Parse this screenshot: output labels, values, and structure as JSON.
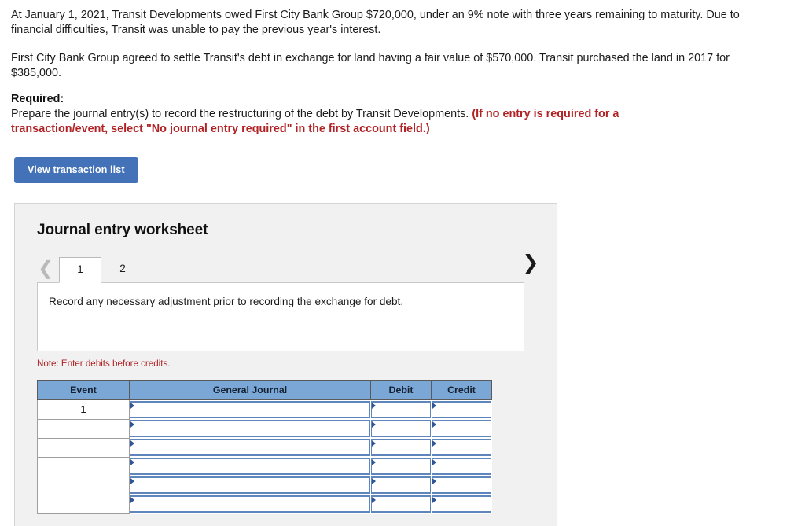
{
  "problem": {
    "paragraph_1": "At January 1, 2021, Transit Developments owed First City Bank Group $720,000, under an 9% note with three years remaining to maturity. Due to financial difficulties, Transit was unable to pay the previous year's interest.",
    "paragraph_2": "First City Bank Group agreed to settle Transit's debt in exchange for land having a fair value of $570,000. Transit purchased the land in 2017 for $385,000.",
    "required_label": "Required:",
    "required_text": "Prepare the journal entry(s) to record the restructuring of the debt by Transit Developments.",
    "required_hint": "(If no entry is required for a transaction/event, select \"No journal entry required\" in the first account field.)"
  },
  "toolbar": {
    "view_transaction_list_label": "View transaction list"
  },
  "worksheet": {
    "title": "Journal entry worksheet",
    "prev_icon": "chevron-left-icon",
    "next_icon": "chevron-right-icon",
    "tabs": [
      {
        "label": "1",
        "active": true
      },
      {
        "label": "2",
        "active": false
      }
    ],
    "instruction": "Record any necessary adjustment prior to recording the exchange for debt.",
    "note": "Note: Enter debits before credits.",
    "table": {
      "headers": [
        "Event",
        "General Journal",
        "Debit",
        "Credit"
      ],
      "rows": [
        {
          "event": "1",
          "general_journal": "",
          "debit": "",
          "credit": ""
        },
        {
          "event": "",
          "general_journal": "",
          "debit": "",
          "credit": ""
        },
        {
          "event": "",
          "general_journal": "",
          "debit": "",
          "credit": ""
        },
        {
          "event": "",
          "general_journal": "",
          "debit": "",
          "credit": ""
        },
        {
          "event": "",
          "general_journal": "",
          "debit": "",
          "credit": ""
        },
        {
          "event": "",
          "general_journal": "",
          "debit": "",
          "credit": ""
        }
      ]
    }
  },
  "colors": {
    "button_blue": "#4472b8",
    "table_header_blue": "#7ba7d7",
    "input_border_blue": "#5e86bd",
    "alert_red": "#b12225",
    "panel_gray": "#f1f1f1"
  }
}
